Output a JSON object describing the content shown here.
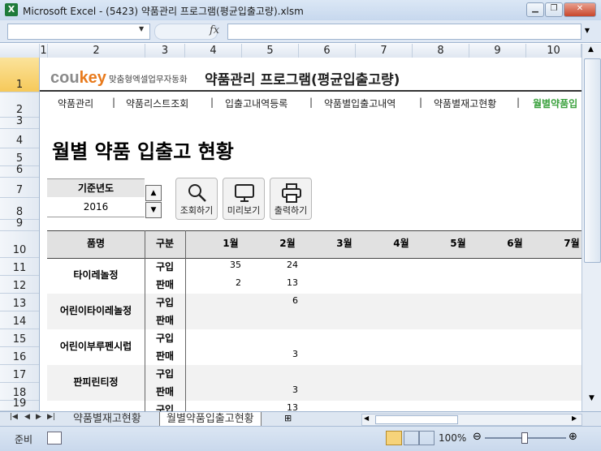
{
  "window": {
    "title": "Microsoft Excel - (5423) 약품관리 프로그램(평균입출고량).xlsm",
    "app_icon": "X"
  },
  "formula_bar": {
    "fx": "fx",
    "name_box": "",
    "formula": ""
  },
  "columns": [
    "1",
    "2",
    "3",
    "4",
    "5",
    "6",
    "7",
    "8",
    "9",
    "10"
  ],
  "rows": [
    "1",
    "2",
    "3",
    "4",
    "5",
    "6",
    "7",
    "8",
    "9",
    "10",
    "11",
    "12",
    "13",
    "14",
    "15",
    "16",
    "17",
    "18",
    "19"
  ],
  "brand": {
    "logo_a": "cou",
    "logo_b": "key",
    "tagline": "맞춤형엑셀업무자동화"
  },
  "app_title": "약품관리 프로그램(평균입출고량)",
  "nav": [
    "약품관리",
    "약품리스트조회",
    "입출고내역등록",
    "약품별입출고내역",
    "약품별재고현황",
    "월별약품입"
  ],
  "nav_sep": "|",
  "heading": "월별 약품 입출고 현황",
  "year": {
    "label": "기준년도",
    "value": "2016"
  },
  "buttons": {
    "search": "조회하기",
    "preview": "미리보기",
    "print": "출력하기"
  },
  "table": {
    "headers": [
      "품명",
      "구분",
      "1월",
      "2월",
      "3월",
      "4월",
      "5월",
      "6월",
      "7월"
    ],
    "kinds": [
      "구입",
      "판매"
    ],
    "products": [
      {
        "name": "타이레놀정",
        "buy": [
          "35",
          "24"
        ],
        "sell": [
          "2",
          "13"
        ]
      },
      {
        "name": "어린이타이레놀정",
        "buy": [
          "",
          "6"
        ],
        "sell": [
          "",
          ""
        ]
      },
      {
        "name": "어린이부루펜시럽",
        "buy": [
          "",
          ""
        ],
        "sell": [
          "",
          "3"
        ]
      },
      {
        "name": "판피린티정",
        "buy": [
          "",
          ""
        ],
        "sell": [
          "",
          "3"
        ]
      },
      {
        "name": "",
        "buy": [
          "",
          "13"
        ],
        "sell": [
          "",
          ""
        ]
      }
    ]
  },
  "tabs": [
    "약품별재고현황",
    "월별약품입출고현황"
  ],
  "status": {
    "ready": "준비",
    "zoom": "100%"
  }
}
